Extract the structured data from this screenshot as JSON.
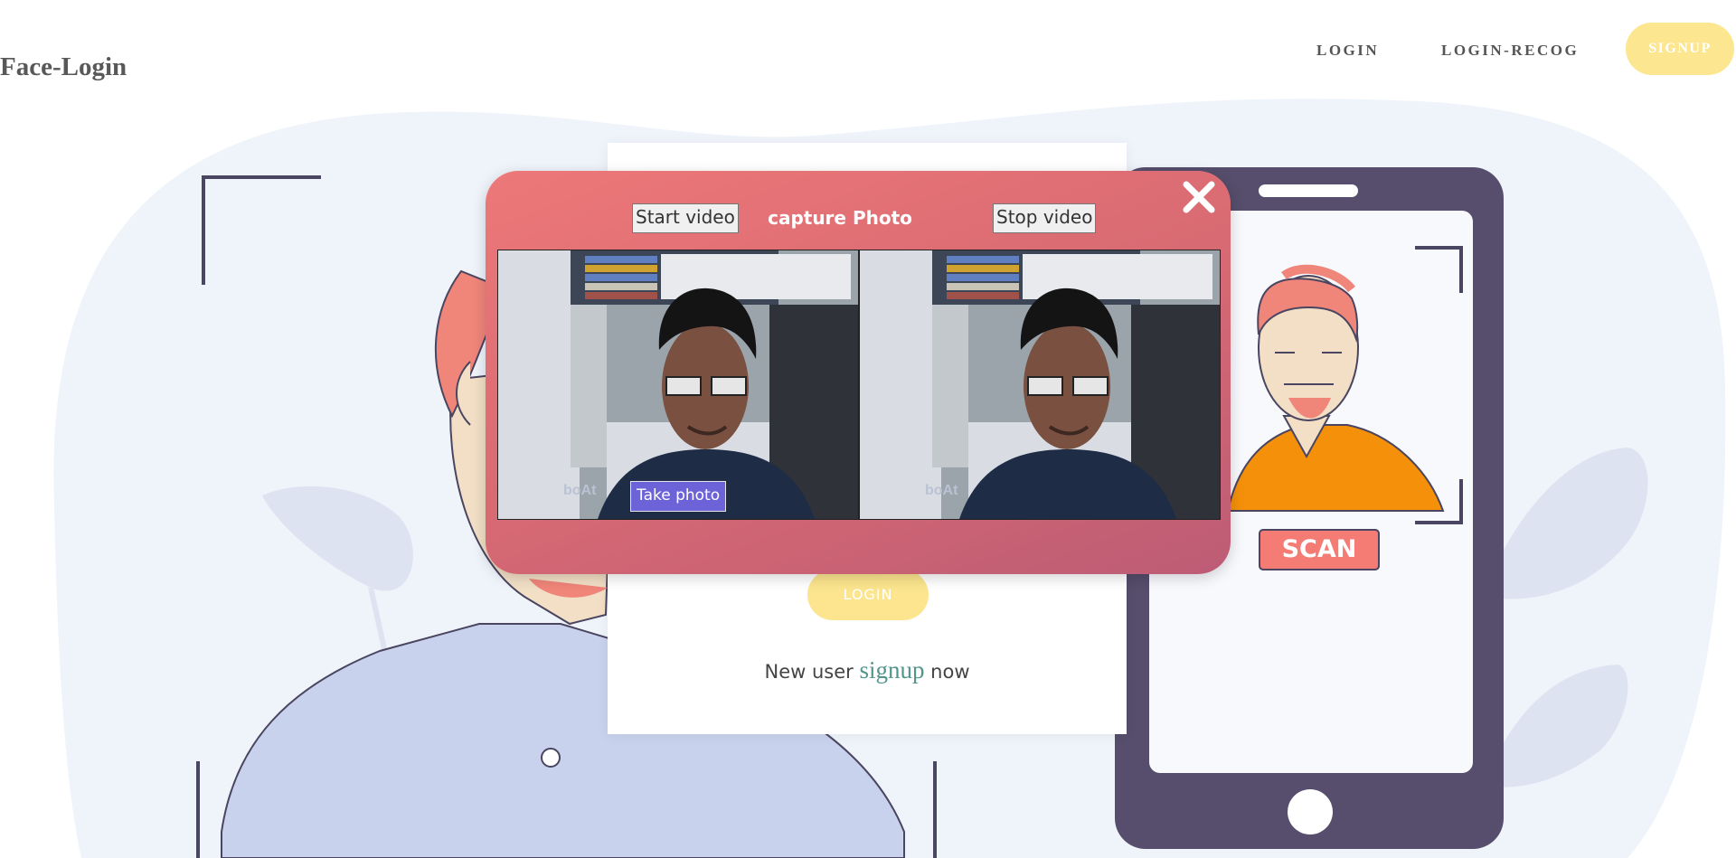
{
  "header": {
    "brand": "Face-Login",
    "nav": {
      "login": "LOGIN",
      "login_recog": "LOGIN-RECOG",
      "signup": "SIGNUP"
    }
  },
  "illustration": {
    "phone_badge": "SCAN"
  },
  "login_card": {
    "login_button": "LOGIN",
    "new_user_prefix": "New user",
    "signup_link": "signup",
    "new_user_suffix": "now"
  },
  "modal": {
    "title": "capture Photo",
    "start_video": "Start video",
    "stop_video": "Stop video",
    "take_photo": "Take photo",
    "video_watermark": "boAt"
  },
  "colors": {
    "accent_yellow": "#fce68f",
    "modal_gradient_start": "#ed7878",
    "modal_gradient_end": "#bd5c75",
    "take_photo_button": "#6c63d8",
    "phone_body": "#564e6c",
    "signup_link": "#52958c"
  }
}
